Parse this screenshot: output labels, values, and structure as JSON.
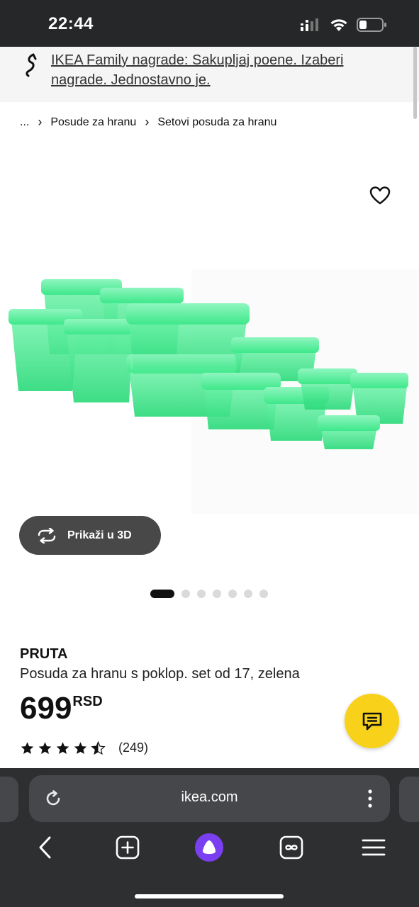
{
  "status_bar": {
    "time": "22:44"
  },
  "promo": {
    "text": "IKEA Family nagrade: Sakupljaj poene. Izaberi nagrade. Jednostavno je."
  },
  "breadcrumb": {
    "items": [
      "...",
      "Posude za hranu",
      "Setovi posuda za hranu"
    ]
  },
  "product": {
    "view_3d_label": "Prikaži u 3D",
    "carousel": {
      "total": 7,
      "active_index": 0
    },
    "brand": "PRUTA",
    "description": "Posuda za hranu s poklop. set od 17, zelena",
    "price": "699",
    "currency": "RSD",
    "rating": {
      "value": 4.5,
      "max": 5,
      "count": "(249)"
    }
  },
  "browser": {
    "url": "ikea.com"
  },
  "colors": {
    "accent_yellow": "#f8d11a",
    "container_green": "#3ee88a",
    "status_bar_bg": "#262728",
    "browser_bg": "#2e2f31",
    "alice_purple": "#7b3ff2"
  },
  "icons": {
    "status": [
      "cellular-icon",
      "wifi-icon",
      "battery-icon"
    ],
    "nav": [
      "back-icon",
      "new-tab-icon",
      "alice-icon",
      "tabs-icon",
      "menu-icon"
    ]
  }
}
